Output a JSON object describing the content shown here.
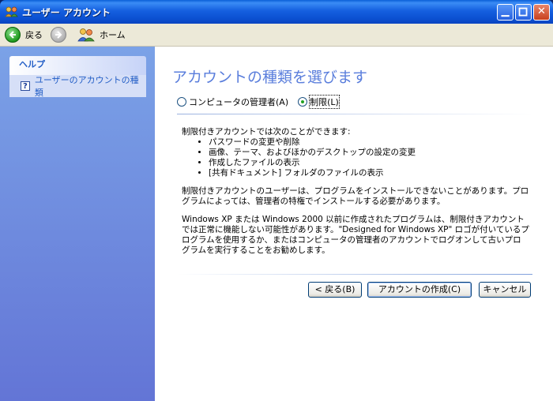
{
  "window": {
    "title": "ユーザー アカウント"
  },
  "toolbar": {
    "back_label": "戻る",
    "home_label": "ホーム"
  },
  "sidebar": {
    "help_header": "ヘルプ",
    "help_link": "ユーザーのアカウントの種類"
  },
  "main": {
    "title": "アカウントの種類を選びます",
    "options": [
      {
        "label": "コンピュータの管理者(A)",
        "selected": false
      },
      {
        "label": "制限(L)",
        "selected": true
      }
    ],
    "intro": "制限付きアカウントでは次のことができます:",
    "bullets": [
      "パスワードの変更や削除",
      "画像、テーマ、およびほかのデスクトップの設定の変更",
      "作成したファイルの表示",
      "[共有ドキュメント] フォルダのファイルの表示"
    ],
    "para1": "制限付きアカウントのユーザーは、プログラムをインストールできないことがあります。プログラムによっては、管理者の特権でインストールする必要があります。",
    "para2": "Windows XP または Windows 2000 以前に作成されたプログラムは、制限付きアカウントでは正常に機能しない可能性があります。\"Designed for Windows XP\" ロゴが付いているプログラムを使用するか、またはコンピュータの管理者のアカウントでログオンして古いプログラムを実行することをお勧めします。"
  },
  "buttons": {
    "back": "< 戻る(B)",
    "create": "アカウントの作成(C)",
    "cancel": "キャンセル"
  },
  "colors": {
    "title_bar": "#0b4fd0",
    "sidebar": "#6f8ddf",
    "heading": "#5a7edc",
    "link": "#215dc6"
  }
}
